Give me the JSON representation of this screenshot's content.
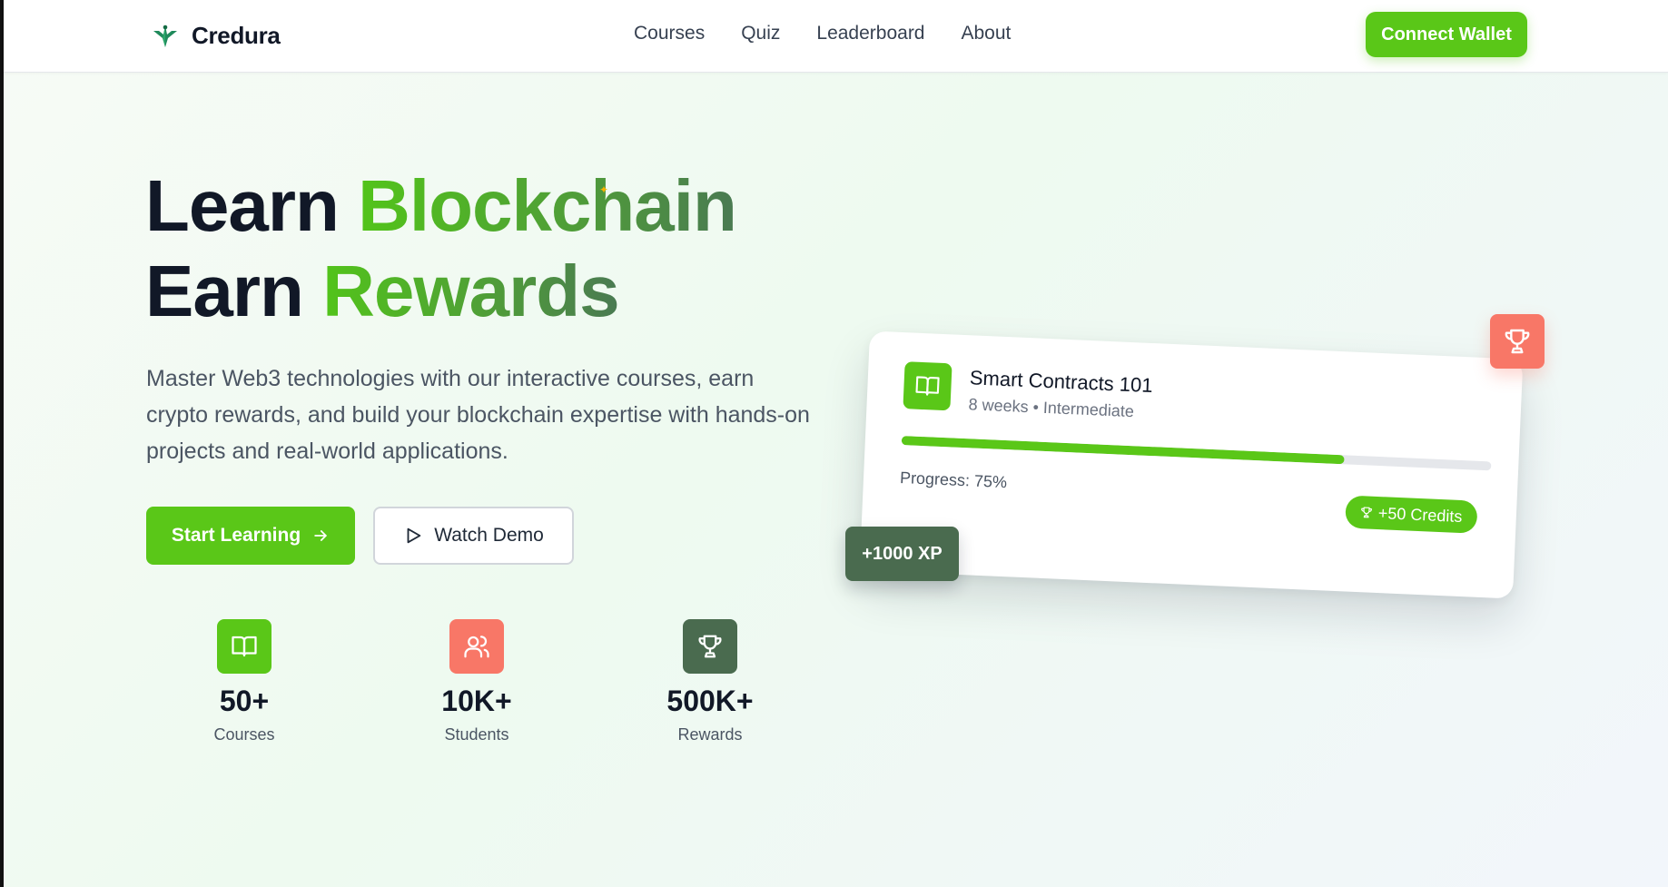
{
  "brand": {
    "name": "Credura"
  },
  "nav": {
    "links": [
      "Courses",
      "Quiz",
      "Leaderboard",
      "About"
    ],
    "cta": "Connect Wallet"
  },
  "hero": {
    "line1_plain": "Learn ",
    "line1_accent": "Blockchain",
    "line2_plain": "Earn ",
    "line2_accent": "Rewards",
    "description": "Master Web3 technologies with our interactive courses, earn crypto rewards, and build your blockchain expertise with hands-on projects and real-world applications.",
    "primary_button": "Start Learning",
    "secondary_button": "Watch Demo"
  },
  "stats": [
    {
      "value": "50+",
      "label": "Courses",
      "icon": "book-icon",
      "color": "#5ac718"
    },
    {
      "value": "10K+",
      "label": "Students",
      "icon": "users-icon",
      "color": "#f87767"
    },
    {
      "value": "500K+",
      "label": "Rewards",
      "icon": "trophy-icon",
      "color": "#4a6b4f"
    }
  ],
  "course_card": {
    "title": "Smart Contracts 101",
    "meta": "8 weeks • Intermediate",
    "progress_fraction": 0.75,
    "progress_text": "Progress: 75%",
    "credits": "+50 Credits"
  },
  "xp_badge": "+1000 XP",
  "colors": {
    "accent": "#5ac718",
    "coral": "#f87767",
    "dark_green": "#4a6b4f"
  }
}
